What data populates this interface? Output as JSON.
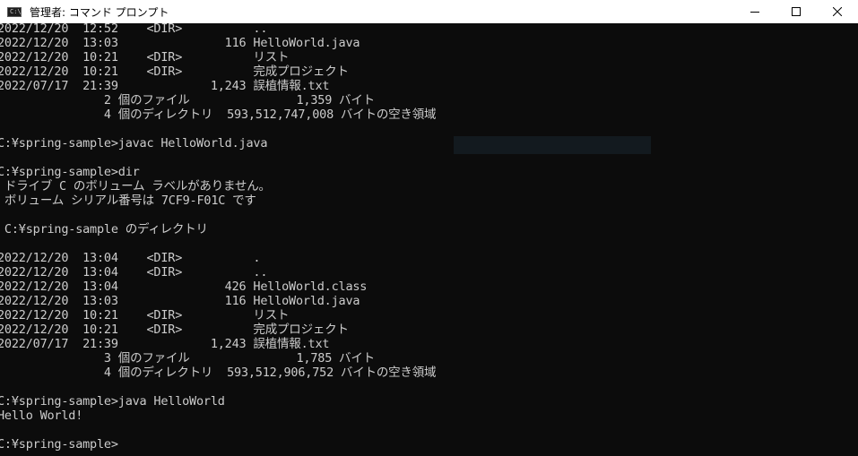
{
  "window": {
    "title": "管理者: コマンド プロンプト",
    "app_icon_text": "C:\\"
  },
  "controls": {
    "minimize_icon": "minimize-icon",
    "maximize_icon": "maximize-icon",
    "close_icon": "close-icon"
  },
  "console": {
    "lines": [
      "2022/12/20  12:52    <DIR>          ..",
      "2022/12/20  13:03               116 HelloWorld.java",
      "2022/12/20  10:21    <DIR>          リスト",
      "2022/12/20  10:21    <DIR>          完成プロジェクト",
      "2022/07/17  21:39             1,243 誤植情報.txt",
      "               2 個のファイル               1,359 バイト",
      "               4 個のディレクトリ  593,512,747,008 バイトの空き領域",
      "",
      "C:¥spring-sample>javac HelloWorld.java",
      "",
      "C:¥spring-sample>dir",
      " ドライブ C のボリューム ラベルがありません。",
      " ボリューム シリアル番号は 7CF9-F01C です",
      "",
      " C:¥spring-sample のディレクトリ",
      "",
      "2022/12/20  13:04    <DIR>          .",
      "2022/12/20  13:04    <DIR>          ..",
      "2022/12/20  13:04               426 HelloWorld.class",
      "2022/12/20  13:03               116 HelloWorld.java",
      "2022/12/20  10:21    <DIR>          リスト",
      "2022/12/20  10:21    <DIR>          完成プロジェクト",
      "2022/07/17  21:39             1,243 誤植情報.txt",
      "               3 個のファイル               1,785 バイト",
      "               4 個のディレクトリ  593,512,906,752 バイトの空き領域",
      "",
      "C:¥spring-sample>java HelloWorld",
      "Hello World!",
      "",
      "C:¥spring-sample>"
    ]
  },
  "colors": {
    "console_background": "#0c0c0c",
    "console_text": "#cccccc",
    "titlebar_background": "#ffffff"
  }
}
